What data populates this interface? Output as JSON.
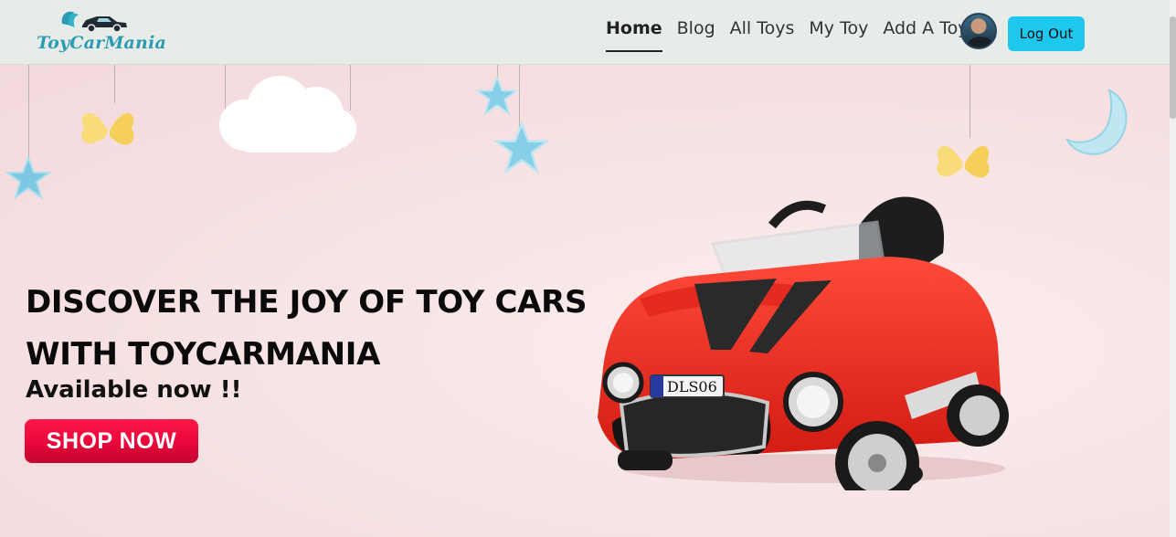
{
  "brand": {
    "name": "ToyCarMania",
    "accent": "#2b9bb4"
  },
  "nav": {
    "links": [
      {
        "label": "Home",
        "active": true
      },
      {
        "label": "Blog",
        "active": false
      },
      {
        "label": "All Toys",
        "active": false
      },
      {
        "label": "My Toy",
        "active": false
      },
      {
        "label": "Add A Toy",
        "active": false
      }
    ],
    "logout_label": "Log Out",
    "logout_color": "#1ec7ee"
  },
  "hero": {
    "title_line1": "DISCOVER THE JOY OF TOY CARS",
    "title_line2": "WITH TOYCARMANIA",
    "subtitle": "Available now !!",
    "cta_label": "SHOP NOW",
    "cta_color": "#e8063a",
    "plate_text": "DLS06"
  }
}
